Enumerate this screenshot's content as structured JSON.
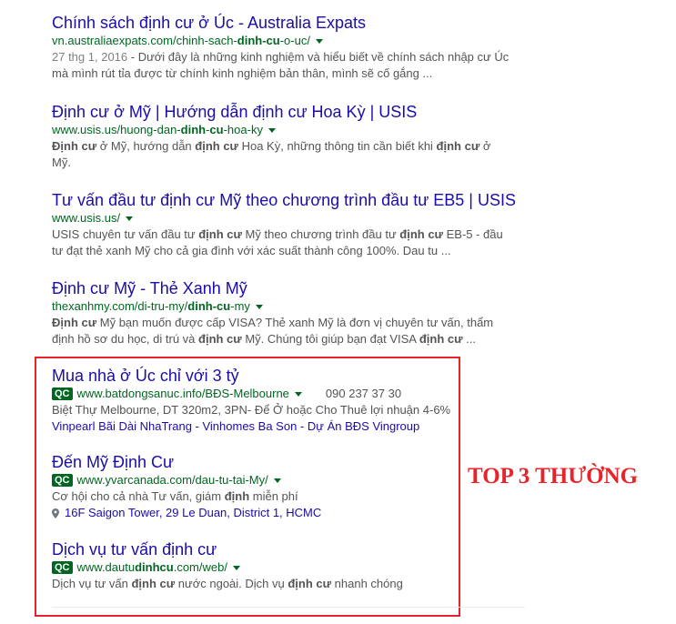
{
  "organic": [
    {
      "title": "Chính sách định cư ở Úc - Australia Expats",
      "url_pre": "vn.australiaexpats.com/chinh-sach-",
      "url_bold": "dinh-cu",
      "url_post": "-o-uc/",
      "date": "27 thg 1, 2016",
      "snippet_1": " - Dưới đây là những kinh nghiệm và hiểu biết về chính sách nhập cư Úc",
      "snippet_2": "mà mình rút tỉa được từ chính kinh nghiệm bản thân, mình sẽ cố gắng ..."
    },
    {
      "title": "Định cư ở Mỹ | Hướng dẫn định cư Hoa Kỳ | USIS",
      "url_pre": "www.usis.us/huong-dan-",
      "url_bold1": "dinh",
      "url_mid": "-",
      "url_bold2": "cu",
      "url_post": "-hoa-ky",
      "s1_b1": "Định cư",
      "s1_t1": " ở Mỹ, hướng dẫn ",
      "s1_b2": "định cư",
      "s1_t2": " Hoa Kỳ, những thông tin cần biết khi ",
      "s1_b3": "định cư",
      "s1_t3": " ở",
      "s2": "Mỹ."
    },
    {
      "title": "Tư vấn đầu tư định cư Mỹ theo chương trình đầu tư EB5 | USIS",
      "url": "www.usis.us/",
      "s1_t1": "USIS chuyên tư vấn đầu tư ",
      "s1_b1": "định cư",
      "s1_t2": " Mỹ theo chương trình đầu tư ",
      "s1_b2": "định cư",
      "s1_t3": " EB-5 - đầu",
      "s2": "tư đạt thẻ xanh Mỹ cho cả gia đình với xác suất thành công 100%. Dau tu ..."
    },
    {
      "title": "Định cư Mỹ - Thẻ Xanh Mỹ",
      "url_pre": "thexanhmy.com/di-tru-my/",
      "url_bold": "dinh-cu",
      "url_post": "-my",
      "s1_b1": "Định cư",
      "s1_t1": " Mỹ bạn muốn được cấp VISA? Thẻ xanh Mỹ là đơn vị chuyên tư vấn, thẩm",
      "s2_t1": "định hồ sơ du học, di trú và ",
      "s2_b1": "định cư",
      "s2_t2": " Mỹ. Chúng tôi giúp bạn đạt VISA ",
      "s2_b2": "định cư",
      "s2_t3": " ..."
    }
  ],
  "ads": [
    {
      "title": "Mua nhà ở Úc chỉ với 3 tỷ",
      "badge": "QC",
      "url": "www.batdongsanuc.info/BĐS-Melbourne",
      "phone": "090 237 37 30",
      "snippet": "Biệt Thự Melbourne, DT 320m2, 3PN- Để Ở hoặc Cho Thuê lợi nhuận 4-6%",
      "sitelinks": [
        "Vinpearl Bãi Dài NhaTrang",
        "Vinhomes Ba Son",
        "Dự Án BĐS Vingroup"
      ],
      "sitelink_sep": " - "
    },
    {
      "title": "Đến Mỹ Định Cư",
      "badge": "QC",
      "url": "www.yvarcanada.com/dau-tu-tai-My/",
      "s_t1": "Cơ hội cho cả nhà Tư vấn, giám ",
      "s_b1": "định",
      "s_t2": " miễn phí",
      "location": "16F Saigon Tower, 29 Le Duan, District 1, HCMC"
    },
    {
      "title": "Dịch vụ tư vấn định cư",
      "badge": "QC",
      "url_pre": "www.dautu",
      "url_bold": "dinhcu",
      "url_post": ".com/web/",
      "s_t1": "Dịch vụ tư vấn ",
      "s_b1": "định cư",
      "s_t2": " nước ngoài. Dịch vụ ",
      "s_b2": "định cư",
      "s_t3": " nhanh chóng"
    }
  ],
  "annotation": "TOP 3 THƯỜNG",
  "colors": {
    "title": "#1a0dab",
    "url": "#006621",
    "snippet": "#545454",
    "annotation": "#e8232a"
  }
}
